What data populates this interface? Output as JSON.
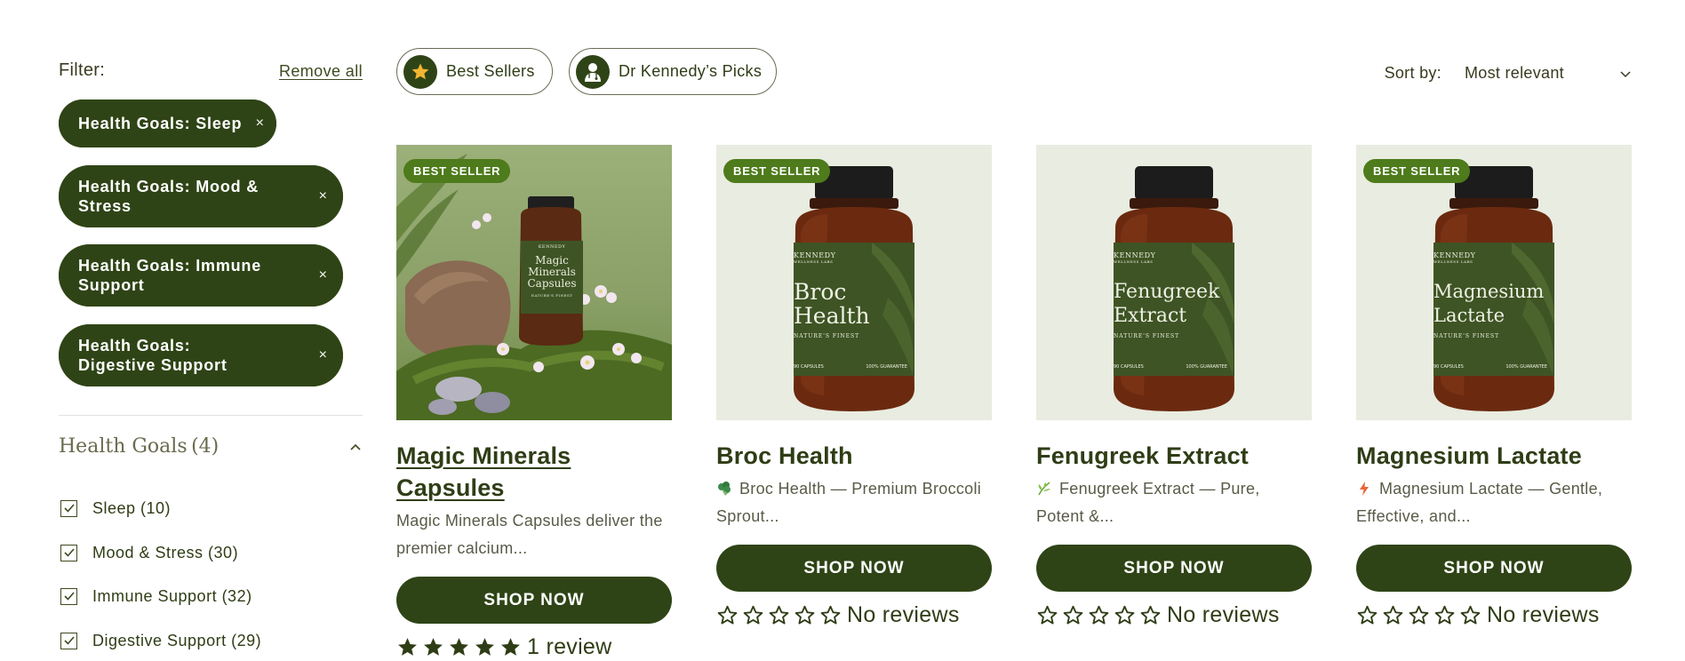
{
  "filters": {
    "label": "Filter:",
    "remove_all": "Remove all",
    "active": [
      {
        "text": "Health Goals: Sleep",
        "close": "×"
      },
      {
        "text": "Health Goals: Mood & Stress",
        "close": "×"
      },
      {
        "text": "Health Goals: Immune Support",
        "close": "×"
      },
      {
        "text": "Health Goals: Digestive Support",
        "close": "×"
      }
    ]
  },
  "facet": {
    "title": "Health Goals",
    "count": "(4)",
    "expanded": true,
    "options": [
      {
        "label": "Sleep (10)",
        "checked": true
      },
      {
        "label": "Mood & Stress (30)",
        "checked": true
      },
      {
        "label": "Immune Support (32)",
        "checked": true
      },
      {
        "label": "Digestive Support (29)",
        "checked": true
      }
    ]
  },
  "quick_filters": [
    {
      "label": "Best Sellers",
      "icon": "star-icon"
    },
    {
      "label": "Dr Kennedy’s Picks",
      "icon": "doctor-icon"
    }
  ],
  "sort": {
    "label": "Sort by:",
    "selected": "Most relevant"
  },
  "colors": {
    "primary": "#2f4416",
    "badge": "#4e7b1b",
    "card_bg": "#e9ece0",
    "label_green": "#3e5424"
  },
  "products": [
    {
      "badge": "BEST SELLER",
      "title": "Magic Minerals Capsules",
      "description": "Magic Minerals Capsules deliver the premier calcium...",
      "cta": "SHOP NOW",
      "rating": 5,
      "reviews": "1 review",
      "label": {
        "brand": "KENNEDY",
        "sub": "WELLNESS LABS",
        "name1": "Magic",
        "name2": "Minerals",
        "name3": "Capsules",
        "tag": "NATURE'S FINEST"
      }
    },
    {
      "badge": "BEST SELLER",
      "title": "Broc Health",
      "description": "Broc Health — Premium Broccoli Sprout...",
      "emoji": "broccoli-icon",
      "cta": "SHOP NOW",
      "rating": 0,
      "reviews": "No reviews",
      "label": {
        "brand": "KENNEDY",
        "sub": "WELLNESS LABS",
        "name1": "Broc",
        "name2": "Health",
        "tag": "NATURE'S FINEST",
        "foot_left": "90 CAPSULES",
        "foot_right": "100% GUARANTEE"
      }
    },
    {
      "badge": "",
      "title": "Fenugreek Extract",
      "description": "Fenugreek Extract — Pure, Potent &...",
      "emoji": "herb-icon",
      "cta": "SHOP NOW",
      "rating": 0,
      "reviews": "No reviews",
      "label": {
        "brand": "KENNEDY",
        "sub": "WELLNESS LABS",
        "name1": "Fenugreek",
        "name2": "Extract",
        "tag": "NATURE'S FINEST",
        "foot_left": "90 CAPSULES",
        "foot_right": "100% GUARANTEE"
      }
    },
    {
      "badge": "BEST SELLER",
      "title": "Magnesium Lactate",
      "description": "Magnesium Lactate — Gentle, Effective, and...",
      "emoji": "lightning-icon",
      "cta": "SHOP NOW",
      "rating": 0,
      "reviews": "No reviews",
      "label": {
        "brand": "KENNEDY",
        "sub": "WELLNESS LABS",
        "name1": "Magnesium",
        "name2": "Lactate",
        "tag": "NATURE'S FINEST",
        "foot_left": "90 CAPSULES",
        "foot_right": "100% GUARANTEE"
      }
    }
  ]
}
